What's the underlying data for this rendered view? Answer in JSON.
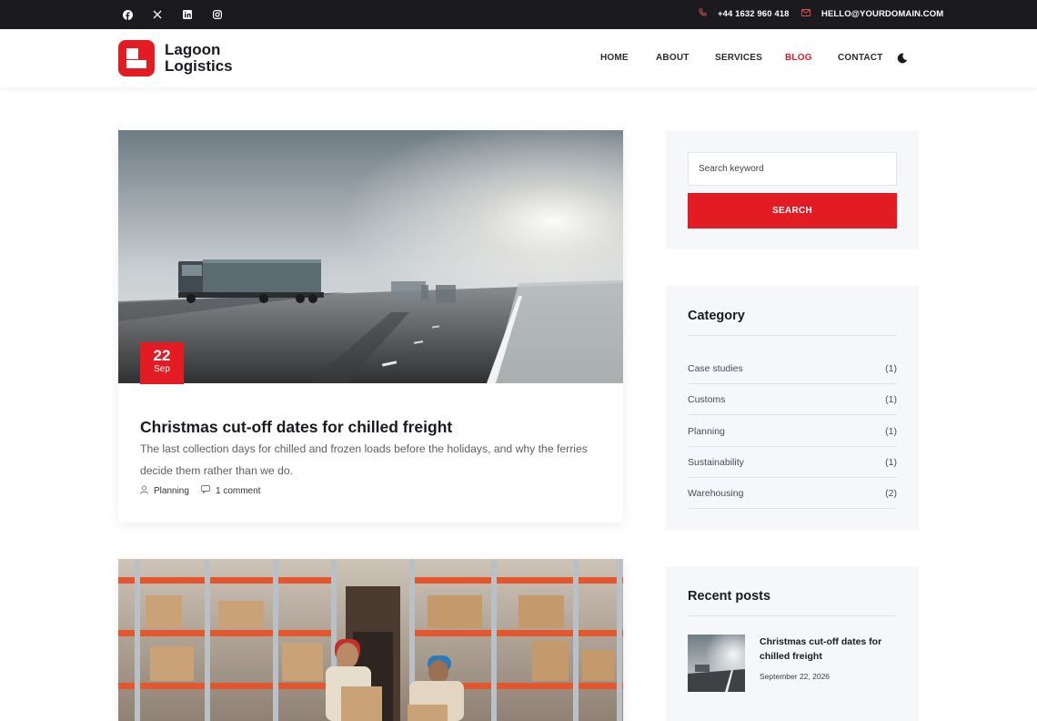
{
  "topbar": {
    "social": [
      "facebook-icon",
      "x-icon",
      "linkedin-icon",
      "instagram-icon"
    ],
    "phone": "+44 1632 960 418",
    "email": "HELLO@YOURDOMAIN.COM"
  },
  "brand": {
    "line1": "Lagoon",
    "line2": "Logistics",
    "color": "#e31b23"
  },
  "nav": {
    "items": [
      "HOME",
      "ABOUT",
      "SERVICES",
      "BLOG",
      "CONTACT"
    ],
    "active": "BLOG",
    "theme_toggle_icon": "moon-icon"
  },
  "posts": [
    {
      "day": "22",
      "month": "Sep",
      "title": "Christmas cut-off dates for chilled freight",
      "excerpt": "The last collection days for chilled and frozen loads before the holidays, and why the ferries decide them rather than we do.",
      "category": "Planning",
      "comments": "1 comment"
    }
  ],
  "sidebar": {
    "search": {
      "placeholder": "Search keyword",
      "button": "SEARCH"
    },
    "category": {
      "title": "Category",
      "items": [
        {
          "name": "Case studies",
          "count": "(1)"
        },
        {
          "name": "Customs",
          "count": "(1)"
        },
        {
          "name": "Planning",
          "count": "(1)"
        },
        {
          "name": "Sustainability",
          "count": "(1)"
        },
        {
          "name": "Warehousing",
          "count": "(2)"
        }
      ]
    },
    "recent": {
      "title": "Recent posts",
      "items": [
        {
          "title": "Christmas cut-off dates for chilled freight",
          "date": "September 22, 2026"
        }
      ]
    }
  }
}
